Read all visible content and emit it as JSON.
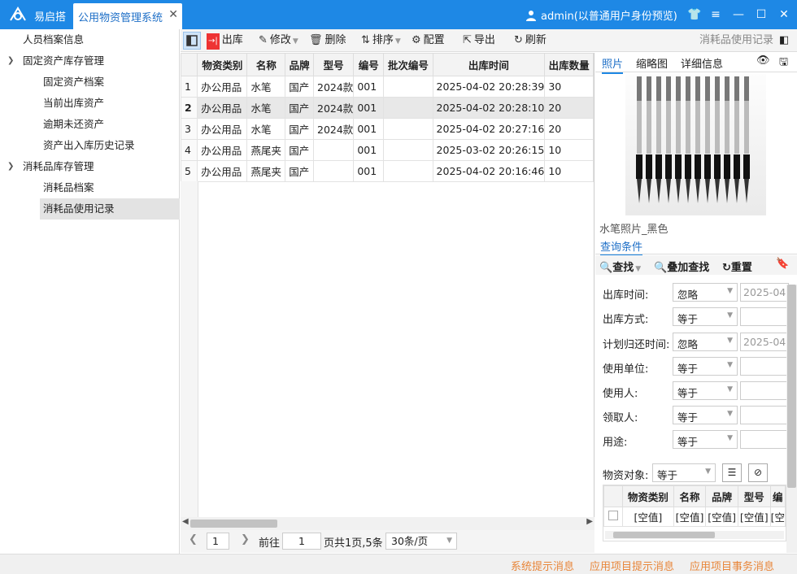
{
  "titlebar": {
    "app_name": "易启搭",
    "active_tab": "公用物资管理系统",
    "user": "admin(以普通用户身份预览)"
  },
  "sidebar": {
    "items": [
      {
        "label": "人员档案信息"
      },
      {
        "label": "固定资产库存管理"
      },
      {
        "label": "固定资产档案"
      },
      {
        "label": "当前出库资产"
      },
      {
        "label": "逾期未还资产"
      },
      {
        "label": "资产出入库历史记录"
      },
      {
        "label": "消耗品库存管理"
      },
      {
        "label": "消耗品档案"
      },
      {
        "label": "消耗品使用记录"
      }
    ]
  },
  "toolbar": {
    "outbound": "出库",
    "edit": "修改",
    "delete": "删除",
    "sort": "排序",
    "config": "配置",
    "export": "导出",
    "refresh": "刷新",
    "view_title": "消耗品使用记录"
  },
  "grid": {
    "columns": [
      "物资类别",
      "名称",
      "品牌",
      "型号",
      "编号",
      "批次编号",
      "出库时间",
      "出库数量"
    ],
    "rows": [
      {
        "n": "1",
        "cat": "办公用品",
        "name": "水笔",
        "brand": "国产",
        "model": "2024款",
        "code": "001",
        "batch": "",
        "time": "2025-04-02 20:28:39",
        "qty": "30"
      },
      {
        "n": "2",
        "cat": "办公用品",
        "name": "水笔",
        "brand": "国产",
        "model": "2024款",
        "code": "001",
        "batch": "",
        "time": "2025-04-02 20:28:10",
        "qty": "20"
      },
      {
        "n": "3",
        "cat": "办公用品",
        "name": "水笔",
        "brand": "国产",
        "model": "2024款",
        "code": "001",
        "batch": "",
        "time": "2025-04-02 20:27:16",
        "qty": "20"
      },
      {
        "n": "4",
        "cat": "办公用品",
        "name": "燕尾夹",
        "brand": "国产",
        "model": "",
        "code": "001",
        "batch": "",
        "time": "2025-03-02 20:26:15",
        "qty": "10"
      },
      {
        "n": "5",
        "cat": "办公用品",
        "name": "燕尾夹",
        "brand": "国产",
        "model": "",
        "code": "001",
        "batch": "",
        "time": "2025-04-02 20:16:46",
        "qty": "10"
      }
    ]
  },
  "pager": {
    "page_nav": "1",
    "goto_label": "前往",
    "goto_value": "1",
    "summary": "页共1页,5条",
    "page_size": "30条/页"
  },
  "right": {
    "tabs": [
      "照片",
      "缩略图",
      "详细信息"
    ],
    "caption": "水笔照片_黑色",
    "query_tab": "查询条件",
    "query_tools": {
      "find": "查找",
      "add_find": "叠加查找",
      "reset": "重置"
    },
    "filters": [
      {
        "label": "出库时间:",
        "op": "忽略",
        "value": "2025-04"
      },
      {
        "label": "出库方式:",
        "op": "等于",
        "value": ""
      },
      {
        "label": "计划归还时间:",
        "op": "忽略",
        "value": "2025-04"
      },
      {
        "label": "使用单位:",
        "op": "等于",
        "value": ""
      },
      {
        "label": "使用人:",
        "op": "等于",
        "value": ""
      },
      {
        "label": "领取人:",
        "op": "等于",
        "value": ""
      },
      {
        "label": "用途:",
        "op": "等于",
        "value": ""
      }
    ],
    "object_label": "物资对象:",
    "object_op": "等于",
    "subgrid": {
      "columns": [
        "物资类别",
        "名称",
        "品牌",
        "型号",
        "编"
      ],
      "row": [
        "[空值]",
        "[空值]",
        "[空值]",
        "[空值]",
        "[空"
      ]
    }
  },
  "status": {
    "sys": "系统提示消息",
    "app": "应用项目提示消息",
    "task": "应用项目事务消息"
  }
}
